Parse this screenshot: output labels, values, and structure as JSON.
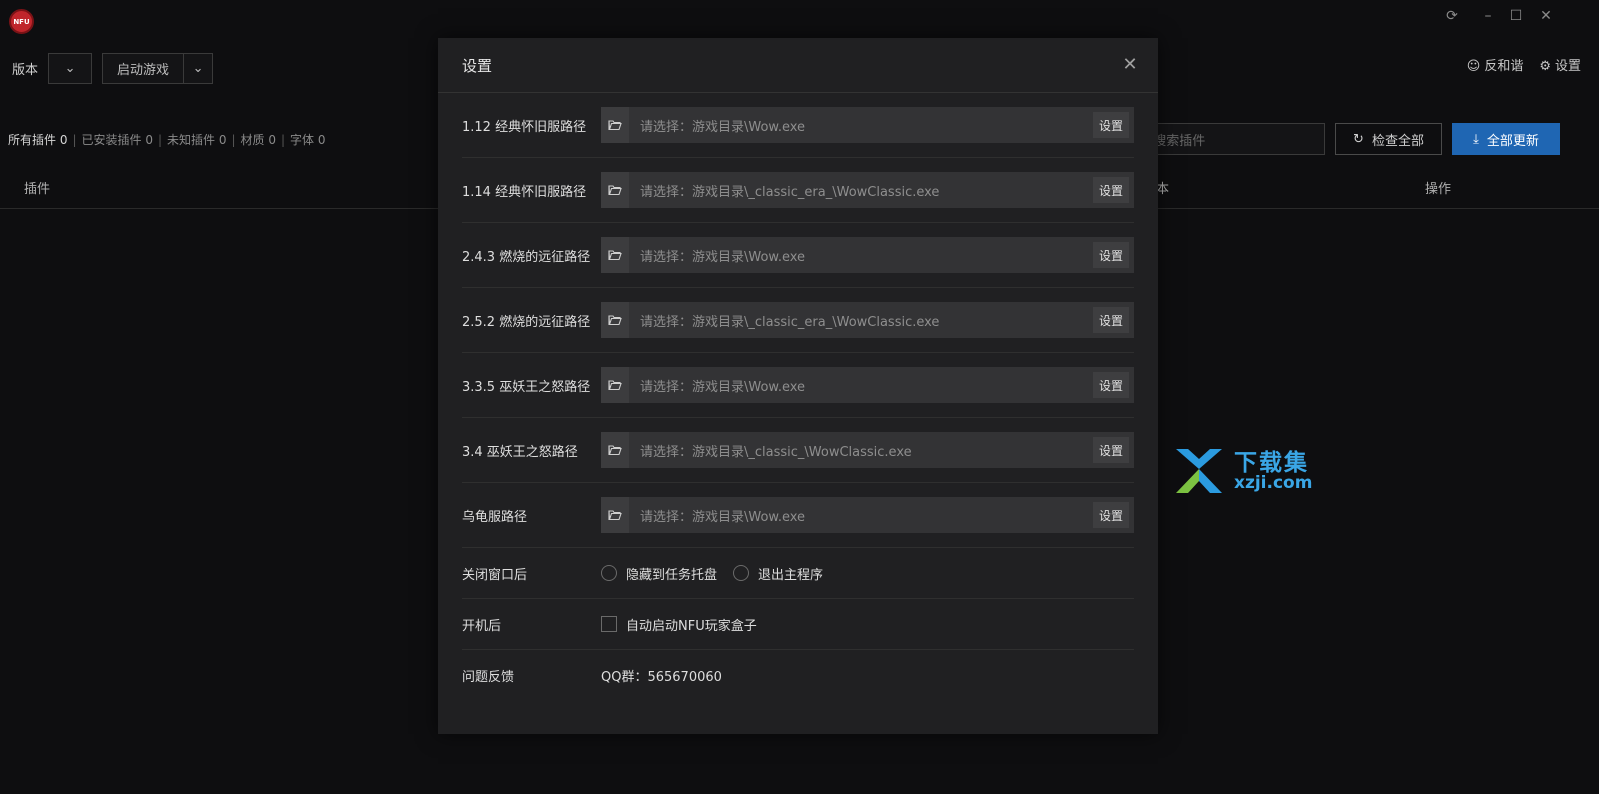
{
  "app": {
    "logo_text": "NFU",
    "version_label": "版本",
    "version_value": "",
    "launch_label": "启动游戏",
    "feedback_label": "反和谐",
    "settings_label": "设置"
  },
  "filters": {
    "all": "所有插件 0",
    "installed": "已安装插件 0",
    "unknown": "未知插件 0",
    "materials": "材质 0",
    "fonts": "字体 0"
  },
  "search": {
    "placeholder": "搜索插件"
  },
  "actions": {
    "check_all": "检查全部",
    "update_all": "全部更新"
  },
  "table": {
    "col_plugin": "插件",
    "col_version": "本",
    "col_op": "操作"
  },
  "watermark": {
    "cn": "下载集",
    "en": "xzji.com"
  },
  "modal": {
    "title": "设置",
    "paths": [
      {
        "label": "1.12 经典怀旧服路径",
        "placeholder": "请选择：游戏目录\\Wow.exe",
        "button": "设置"
      },
      {
        "label": "1.14 经典怀旧服路径",
        "placeholder": "请选择：游戏目录\\_classic_era_\\WowClassic.exe",
        "button": "设置"
      },
      {
        "label": "2.4.3 燃烧的远征路径",
        "placeholder": "请选择：游戏目录\\Wow.exe",
        "button": "设置"
      },
      {
        "label": "2.5.2 燃烧的远征路径",
        "placeholder": "请选择：游戏目录\\_classic_era_\\WowClassic.exe",
        "button": "设置"
      },
      {
        "label": "3.3.5 巫妖王之怒路径",
        "placeholder": "请选择：游戏目录\\Wow.exe",
        "button": "设置"
      },
      {
        "label": "3.4 巫妖王之怒路径",
        "placeholder": "请选择：游戏目录\\_classic_\\WowClassic.exe",
        "button": "设置"
      },
      {
        "label": "乌龟服路径",
        "placeholder": "请选择：游戏目录\\Wow.exe",
        "button": "设置"
      }
    ],
    "close_behavior": {
      "label": "关闭窗口后",
      "option1": "隐藏到任务托盘",
      "option2": "退出主程序"
    },
    "startup": {
      "label": "开机后",
      "option": "自动启动NFU玩家盒子"
    },
    "feedback": {
      "label": "问题反馈",
      "value": "QQ群：565670060"
    }
  }
}
